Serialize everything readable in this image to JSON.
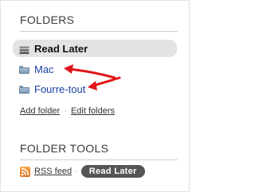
{
  "folders_section": {
    "heading": "FOLDERS",
    "items": [
      {
        "label": "Read Later",
        "icon": "stack-icon",
        "selected": true
      },
      {
        "label": "Mac",
        "icon": "folder-icon",
        "selected": false
      },
      {
        "label": "Fourre-tout",
        "icon": "folder-icon",
        "selected": false
      }
    ],
    "add_folder_label": "Add folder",
    "separator": "·",
    "edit_folders_label": "Edit folders"
  },
  "tools_section": {
    "heading": "FOLDER TOOLS",
    "rss_label": "RSS feed",
    "separator": "·",
    "read_later_button_label": "Read Later"
  },
  "annotation_colors": {
    "arrow": "#e0161b"
  },
  "colors": {
    "link": "#1a3fa5",
    "selected_bg": "#e3e3e3",
    "badge_bg": "#555555",
    "rss_orange": "#e0701b"
  }
}
